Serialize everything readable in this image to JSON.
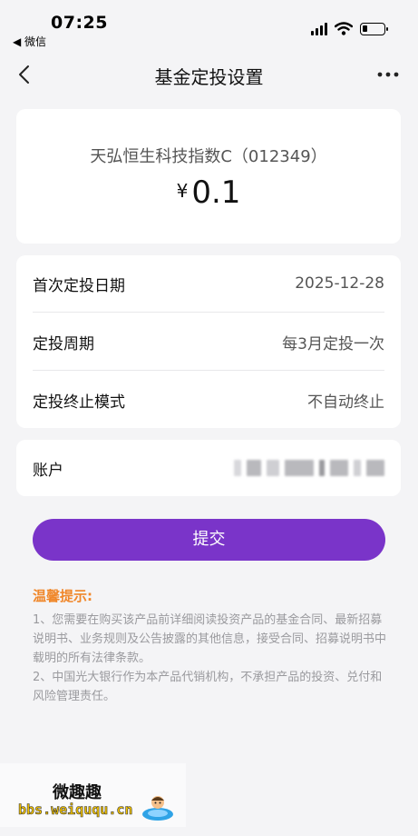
{
  "status_bar": {
    "time": "07:25",
    "back_app": "◀ 微信",
    "battery_level": 0.25
  },
  "nav": {
    "title": "基金定投设置",
    "back_icon": "chevron-left-icon",
    "more_icon": "more-icon"
  },
  "fund": {
    "name": "天弘恒生科技指数C（012349）",
    "currency": "¥",
    "amount": "0.1"
  },
  "settings": {
    "rows": [
      {
        "label": "首次定投日期",
        "value": "2025-12-28"
      },
      {
        "label": "定投周期",
        "value": "每3月定投一次"
      },
      {
        "label": "定投终止模式",
        "value": "不自动终止"
      }
    ]
  },
  "account": {
    "label": "账户"
  },
  "submit": {
    "label": "提交"
  },
  "tips": {
    "title": "温馨提示:",
    "items": [
      "1、您需要在购买该产品前详细阅读投资产品的基金合同、最新招募说明书、业务规则及公告披露的其他信息，接受合同、招募说明书中载明的所有法律条款。",
      "2、中国光大银行作为本产品代销机构，不承担产品的投资、兑付和风险管理责任。"
    ]
  },
  "watermark": {
    "title": "微趣趣",
    "url": "bbs.weiququ.cn"
  },
  "colors": {
    "accent": "#7a34c9",
    "tips_title": "#f0872a",
    "background": "#f4f4f6"
  }
}
